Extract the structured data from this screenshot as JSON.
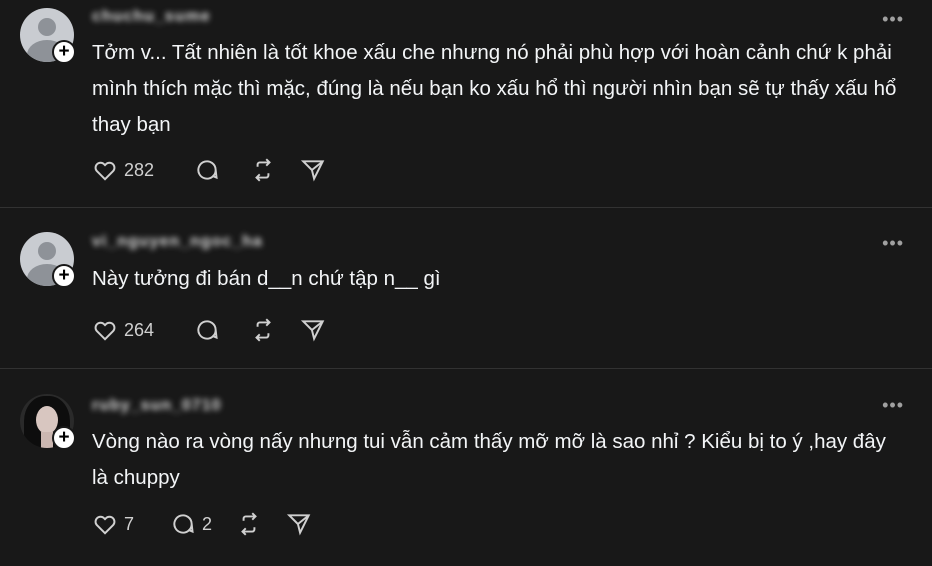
{
  "posts": [
    {
      "username": "chuchu_sume",
      "text": "Tởm v... Tất nhiên là tốt khoe xấu che nhưng nó phải phù hợp với hoàn cảnh chứ k phải mình thích mặc thì mặc, đúng là nếu bạn ko xấu hổ thì người nhìn bạn sẽ tự thấy xấu hổ thay bạn",
      "likes": "282",
      "replies": "",
      "more_label": "•••"
    },
    {
      "username": "vi_nguyen_ngoc_ha",
      "text": "Này tưởng đi bán d__n chứ tập n__ gì",
      "likes": "264",
      "replies": "",
      "more_label": "•••"
    },
    {
      "username": "ruby_sun_0710",
      "text": "Vòng nào ra vòng nấy nhưng tui vẫn cảm thấy mỡ mỡ là sao nhỉ ? Kiểu bị to ý ,hay đây là chuppy",
      "likes": "7",
      "replies": "2",
      "more_label": "•••"
    }
  ],
  "follow_symbol": "+"
}
